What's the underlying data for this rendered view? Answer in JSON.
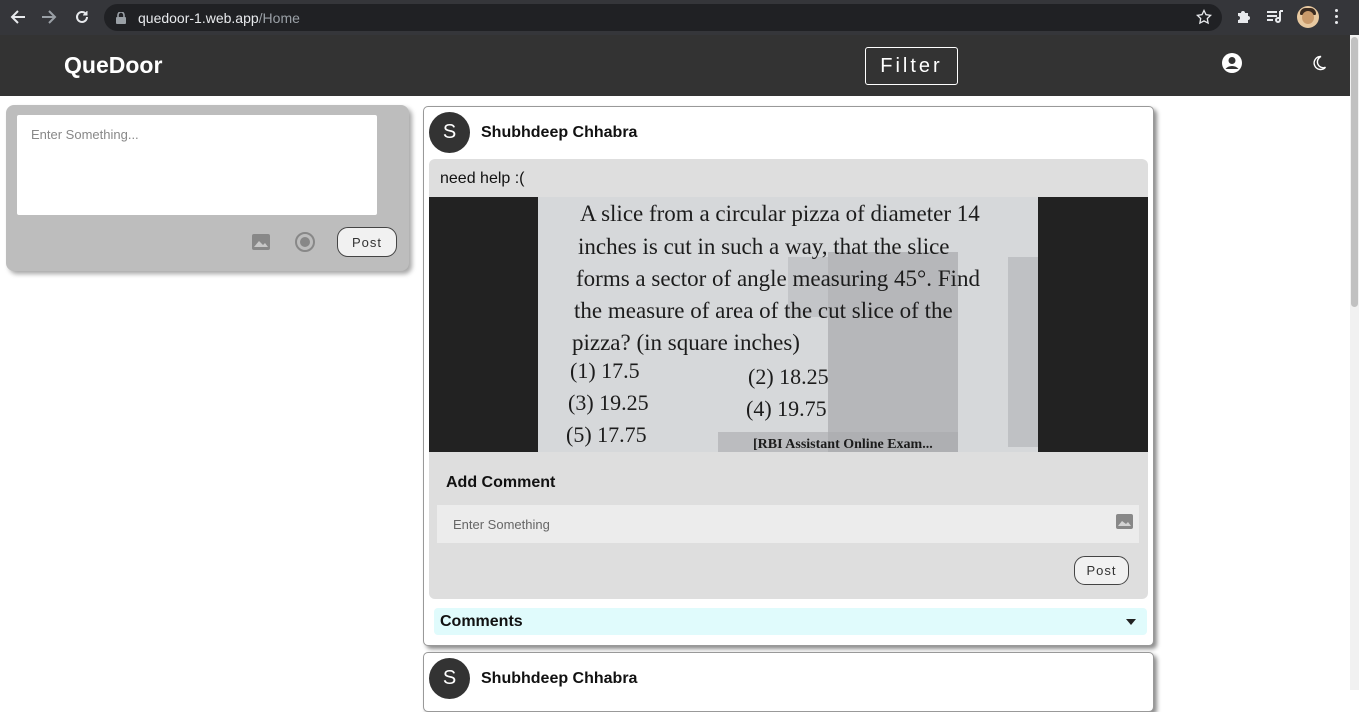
{
  "browser": {
    "url_host": "quedoor-1.web.app",
    "url_path": "/Home"
  },
  "header": {
    "brand": "QueDoor",
    "filter_label": "Filter"
  },
  "composer": {
    "placeholder": "Enter Something...",
    "post_label": "Post"
  },
  "posts": [
    {
      "avatar_initial": "S",
      "author": "Shubhdeep Chhabra",
      "text": "need help :(",
      "image": {
        "question_lines": [
          "A slice from a circular pizza of diameter 14",
          "inches is cut in such a way, that the slice",
          "forms a sector of angle measuring 45°. Find",
          "the measure of area of the cut slice of the",
          "pizza? (in square inches)"
        ],
        "options": [
          "(1) 17.5",
          "(2) 18.25",
          "(3) 19.25",
          "(4) 19.75",
          "(5) 17.75"
        ],
        "source": "[RBI Assistant Online Exam..."
      },
      "add_comment_title": "Add Comment",
      "comment_placeholder": "Enter Something",
      "comment_post_label": "Post",
      "comments_label": "Comments"
    },
    {
      "avatar_initial": "S",
      "author": "Shubhdeep Chhabra"
    }
  ]
}
